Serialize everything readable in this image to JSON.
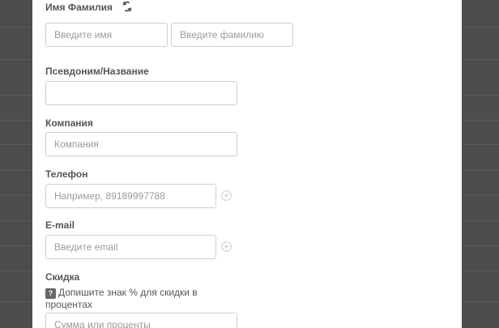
{
  "form": {
    "name": {
      "label": "Имя Фамилия",
      "first_placeholder": "Введите имя",
      "last_placeholder": "Введите фамилию",
      "refresh_icon": "refresh-icon"
    },
    "nickname": {
      "label": "Псевдоним/Название",
      "placeholder": ""
    },
    "company": {
      "label": "Компания",
      "placeholder": "Компания"
    },
    "phone": {
      "label": "Телефон",
      "placeholder": "Например, 89189997788",
      "add_icon": "plus-circle-icon"
    },
    "email": {
      "label": "E-mail",
      "placeholder": "Введите email",
      "add_icon": "plus-circle-icon"
    },
    "discount": {
      "label": "Скидка",
      "help_badge": "?",
      "hint": "Допишите знак % для скидки в процентах",
      "placeholder": "Сумма или проценты"
    }
  },
  "colors": {
    "backdrop": "#4d4d4d",
    "modal": "#ffffff",
    "label": "#555555",
    "border": "#cfcfcf",
    "placeholder": "#9a9a9a",
    "icon": "#cccccc"
  }
}
